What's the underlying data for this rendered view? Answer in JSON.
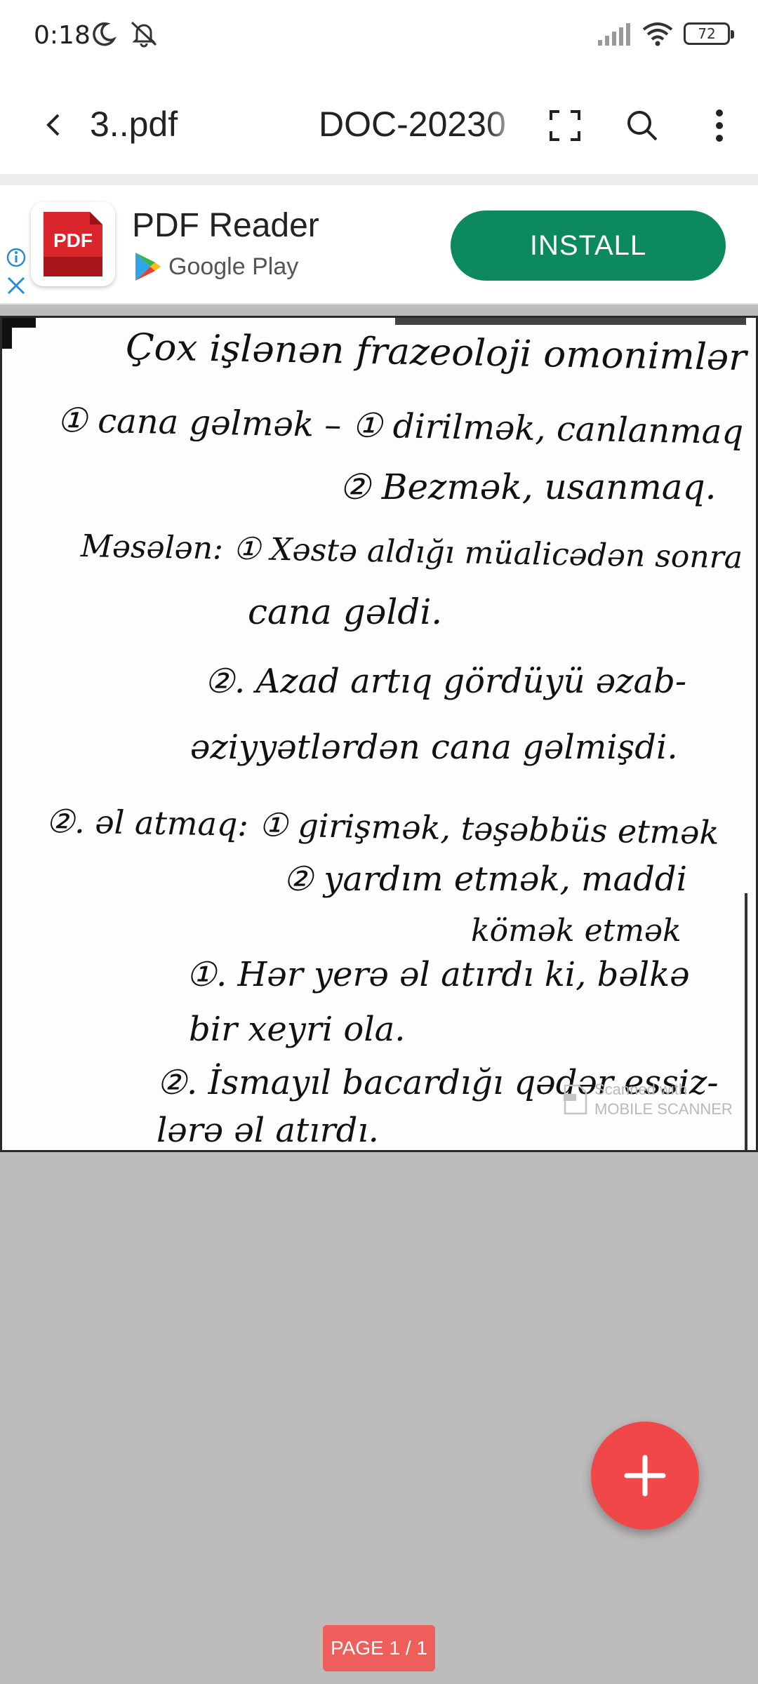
{
  "status_bar": {
    "time": "0:18",
    "battery_level": "72",
    "icons": [
      "moon-icon",
      "bell-off-icon",
      "signal-icon",
      "wifi-icon",
      "battery-icon"
    ]
  },
  "toolbar": {
    "back_icon": "back-arrow-icon",
    "file_name": "3..pdf",
    "doc_title": "DOC-20230",
    "icons": [
      "fullscreen-icon",
      "search-icon",
      "more-vert-icon"
    ]
  },
  "ad": {
    "app_icon_text": "PDF",
    "title": "PDF Reader",
    "store": "Google Play",
    "install_label": "INSTALL",
    "colors": {
      "install": "#0c8a5e",
      "app_icon": "#d9252b"
    }
  },
  "document": {
    "lines": [
      "Çox işlənən frazeoloji omonimlər",
      "① cana gəlmək – ① dirilmək, canlanmaq",
      "② Bezmək, usanmaq.",
      "Məsələn: ① Xəstə aldığı müalicədən sonra",
      "cana gəldi.",
      "②. Azad artıq gördüyü əzab-",
      "əziyyətlərdən cana gəlmişdi.",
      "②. əl atmaq: ① girişmək, təşəbbüs etmək",
      "② yardım etmək, maddi",
      "kömək etmək",
      "①. Hər yerə əl atırdı ki, bəlkə",
      "bir xeyri ola.",
      "②. İsmayıl bacardığı qədər essiz-",
      "lərə əl atırdı."
    ],
    "watermark": [
      "Scanned with",
      "MOBILE SCANNER"
    ]
  },
  "fab_icon": "plus-icon",
  "page_indicator": "PAGE 1 / 1",
  "colors": {
    "fab": "#f04848",
    "page_indicator": "#ee5f5c",
    "viewer_bg": "#bdbbbc"
  }
}
